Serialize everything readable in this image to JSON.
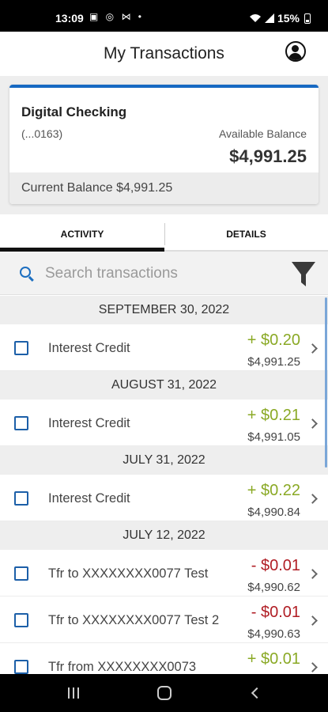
{
  "status_bar": {
    "time": "13:09",
    "left_icons": "▣ ◎ ⋈ •",
    "battery": "15%"
  },
  "header": {
    "title": "My Transactions"
  },
  "account": {
    "name": "Digital Checking",
    "number": "(...0163)",
    "available_label": "Available Balance",
    "available_balance": "$4,991.25",
    "current_balance_text": "Current Balance $4,991.25"
  },
  "tabs": [
    {
      "label": "ACTIVITY",
      "active": true
    },
    {
      "label": "DETAILS",
      "active": false
    }
  ],
  "search": {
    "placeholder": "Search transactions",
    "value": ""
  },
  "groups": [
    {
      "date": "SEPTEMBER 30, 2022",
      "transactions": [
        {
          "desc": "Interest Credit",
          "amount": "+ $0.20",
          "balance": "$4,991.25",
          "type": "credit"
        }
      ]
    },
    {
      "date": "AUGUST 31, 2022",
      "transactions": [
        {
          "desc": "Interest Credit",
          "amount": "+ $0.21",
          "balance": "$4,991.05",
          "type": "credit"
        }
      ]
    },
    {
      "date": "JULY 31, 2022",
      "transactions": [
        {
          "desc": "Interest Credit",
          "amount": "+ $0.22",
          "balance": "$4,990.84",
          "type": "credit"
        }
      ]
    },
    {
      "date": "JULY 12, 2022",
      "transactions": [
        {
          "desc": "Tfr to XXXXXXXX0077 Test",
          "amount": "- $0.01",
          "balance": "$4,990.62",
          "type": "debit"
        },
        {
          "desc": "Tfr to XXXXXXXX0077 Test 2",
          "amount": "- $0.01",
          "balance": "$4,990.63",
          "type": "debit"
        },
        {
          "desc": "Tfr from XXXXXXXX0073",
          "amount": "+ $0.01",
          "balance": "",
          "type": "credit"
        }
      ]
    }
  ],
  "colors": {
    "accent": "#1769c2",
    "credit": "#8aa925",
    "debit": "#b01d24"
  }
}
